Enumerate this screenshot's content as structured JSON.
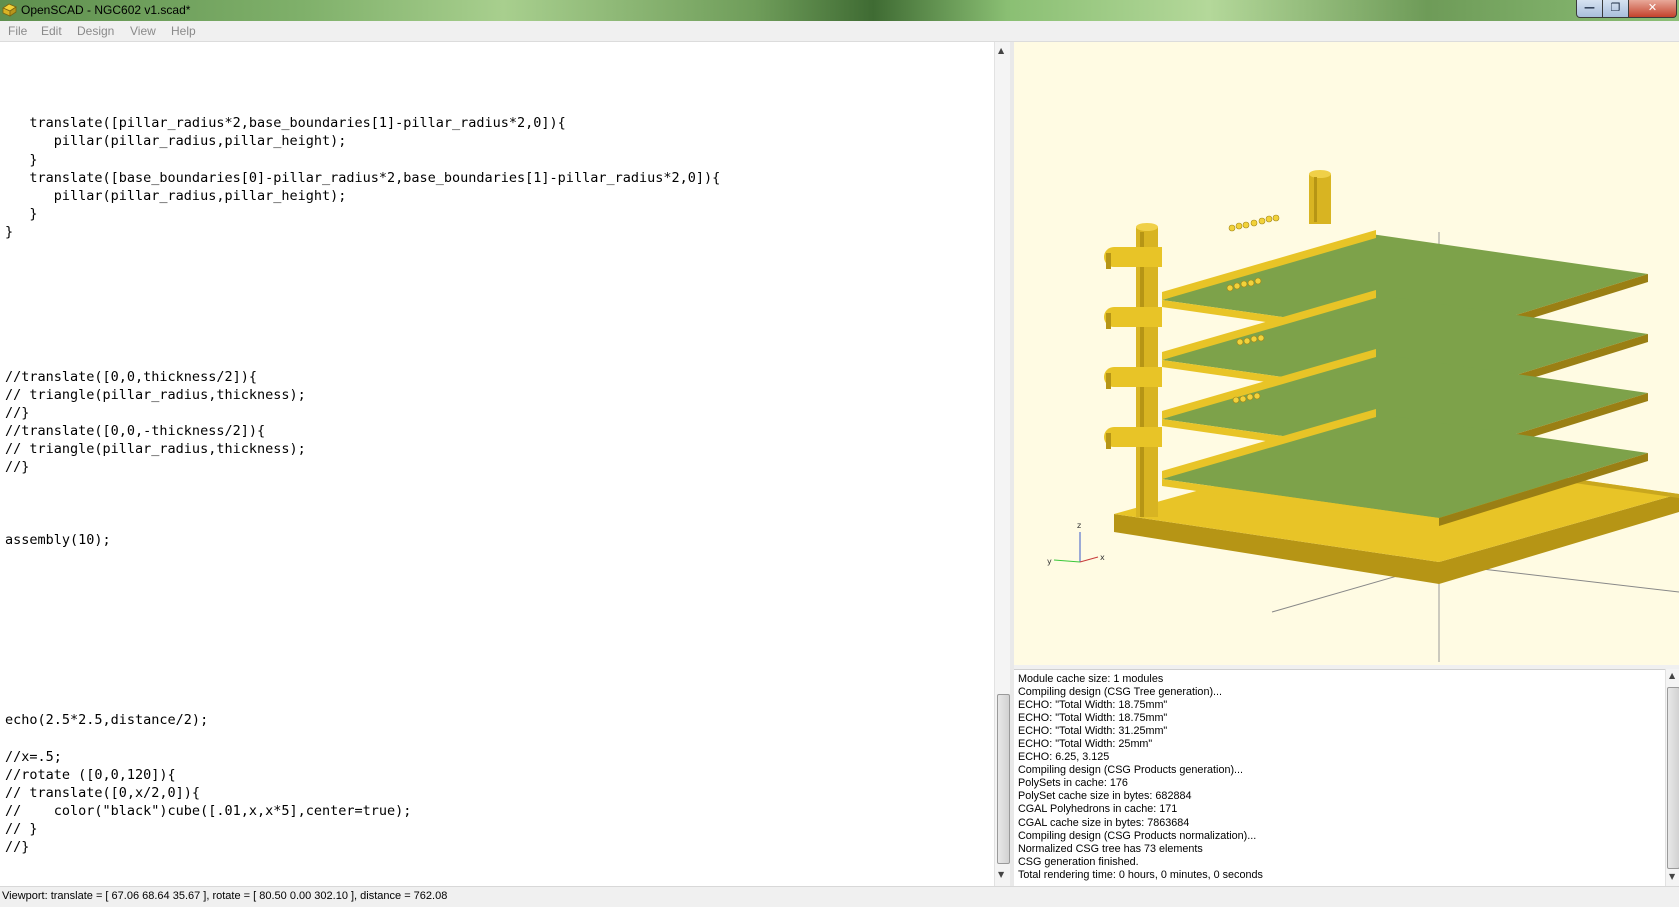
{
  "window": {
    "title": "OpenSCAD - NGC602 v1.scad*"
  },
  "menu": [
    "File",
    "Edit",
    "Design",
    "View",
    "Help"
  ],
  "editor": {
    "lines": [
      "",
      "",
      "",
      "",
      "   translate([pillar_radius*2,base_boundaries[1]-pillar_radius*2,0]){",
      "      pillar(pillar_radius,pillar_height);",
      "   }",
      "   translate([base_boundaries[0]-pillar_radius*2,base_boundaries[1]-pillar_radius*2,0]){",
      "      pillar(pillar_radius,pillar_height);",
      "   }",
      "}",
      "",
      "",
      "",
      "",
      "",
      "",
      "",
      "//translate([0,0,thickness/2]){",
      "// triangle(pillar_radius,thickness);",
      "//}",
      "//translate([0,0,-thickness/2]){",
      "// triangle(pillar_radius,thickness);",
      "//}",
      "",
      "",
      "",
      "assembly(10);",
      "",
      "",
      "",
      "",
      "",
      "",
      "",
      "",
      "",
      "echo(2.5*2.5,distance/2);",
      "",
      "//x=.5;",
      "//rotate ([0,0,120]){",
      "// translate([0,x/2,0]){",
      "//    color(\"black\")cube([.01,x,x*5],center=true);",
      "// }",
      "//}"
    ]
  },
  "viewport": {
    "axes": {
      "x": "x",
      "y": "y",
      "z": "z"
    },
    "colors": {
      "background": "#fffbe3",
      "body": "#e8c427",
      "board": "#7da24a",
      "edge_dark": "#9a7f14"
    }
  },
  "console": {
    "lines": [
      "Module cache size: 1 modules",
      "Compiling design (CSG Tree generation)...",
      "ECHO: \"Total Width: 18.75mm\"",
      "ECHO: \"Total Width: 18.75mm\"",
      "ECHO: \"Total Width: 31.25mm\"",
      "ECHO: \"Total Width: 25mm\"",
      "ECHO: 6.25, 3.125",
      "Compiling design (CSG Products generation)...",
      "PolySets in cache: 176",
      "PolySet cache size in bytes: 682884",
      "CGAL Polyhedrons in cache: 171",
      "CGAL cache size in bytes: 7863684",
      "Compiling design (CSG Products normalization)...",
      "Normalized CSG tree has 73 elements",
      "CSG generation finished.",
      "Total rendering time: 0 hours, 0 minutes, 0 seconds"
    ]
  },
  "statusbar": {
    "text": "Viewport: translate = [ 67.06 68.64 35.67 ], rotate = [ 80.50 0.00 302.10 ], distance = 762.08"
  }
}
